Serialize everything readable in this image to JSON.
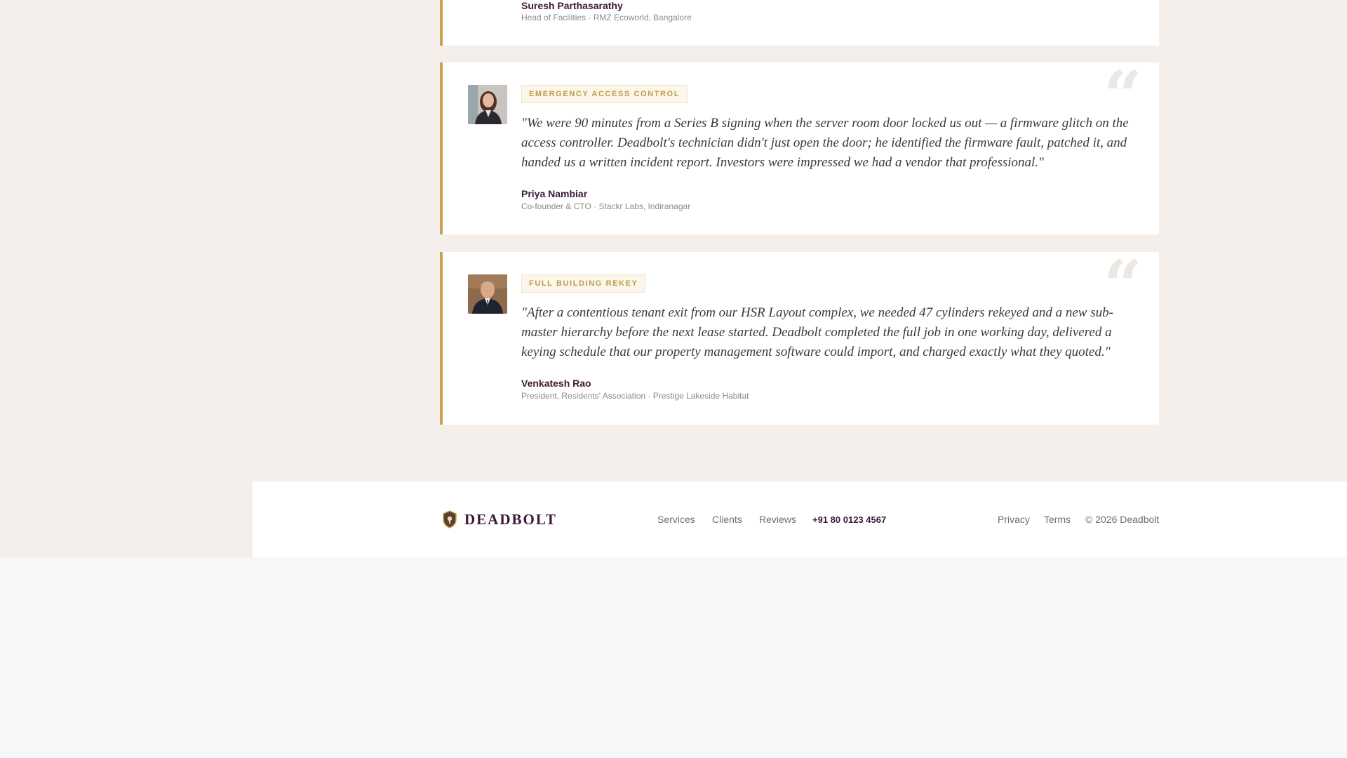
{
  "testimonials": [
    {
      "tag": "",
      "quote": "",
      "name": "Suresh Parthasarathy",
      "role": "Head of Facilities · RMZ Ecoworld, Bangalore"
    },
    {
      "tag": "EMERGENCY ACCESS CONTROL",
      "quote": "\"We were 90 minutes from a Series B signing when the server room door locked us out — a firmware glitch on the access controller. Deadbolt's technician didn't just open the door; he identified the firmware fault, patched it, and handed us a written incident report. Investors were impressed we had a vendor that professional.\"",
      "name": "Priya Nambiar",
      "role": "Co-founder & CTO · Stackr Labs, Indiranagar"
    },
    {
      "tag": "FULL BUILDING REKEY",
      "quote": "\"After a contentious tenant exit from our HSR Layout complex, we needed 47 cylinders rekeyed and a new sub-master hierarchy before the next lease started. Deadbolt completed the full job in one working day, delivered a keying schedule that our property management software could import, and charged exactly what they quoted.\"",
      "name": "Venkatesh Rao",
      "role": "President, Residents' Association · Prestige Lakeside Habitat"
    }
  ],
  "quote_glyph": "“",
  "footer": {
    "brand": "DEADBOLT",
    "nav": [
      "Services",
      "Clients",
      "Reviews"
    ],
    "phone": "+91 80 0123 4567",
    "legal": [
      "Privacy",
      "Terms",
      "© 2026 Deadbolt"
    ]
  },
  "colors": {
    "accent_gold": "#c9a24f",
    "brand_plum": "#3c1836",
    "page_background": "#f4efea"
  }
}
